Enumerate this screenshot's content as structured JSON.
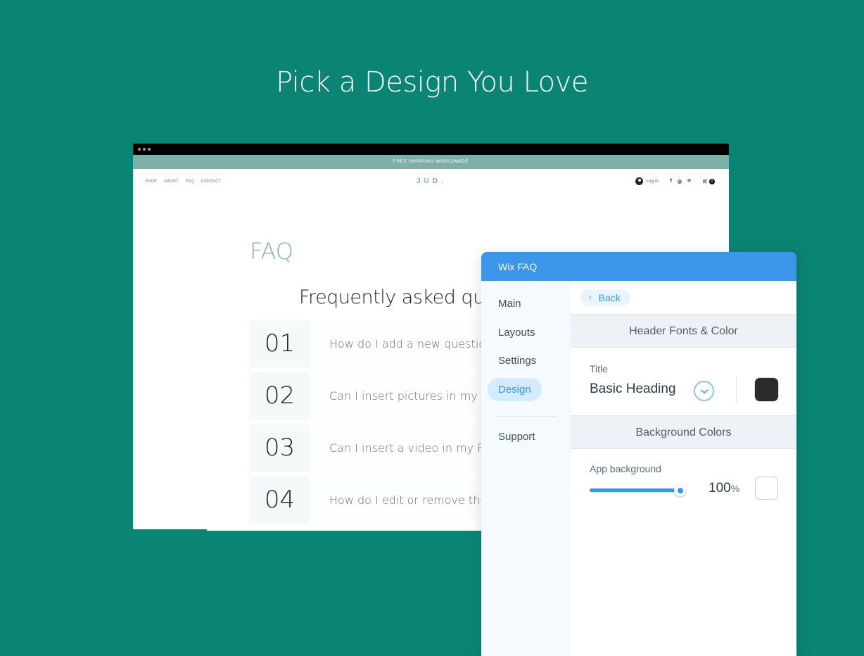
{
  "hero": {
    "title": "Pick a Design You Love"
  },
  "site": {
    "promo": "FREE SHIPPING WORLDWIDE",
    "nav": [
      "SHOP",
      "ABOUT",
      "FAQ",
      "CONTACT"
    ],
    "logo": "JUD.",
    "login": "Log In",
    "social": {
      "facebook": "f",
      "instagram": "◎",
      "pinterest": "℗"
    },
    "cart_count": "0",
    "faq_title": "FAQ",
    "faq_subtitle": "Frequently asked questions",
    "questions": [
      {
        "num": "01",
        "text": "How do I add a new question?"
      },
      {
        "num": "02",
        "text": "Can I insert pictures in my FAQ?"
      },
      {
        "num": "03",
        "text": "Can I insert a video in my FAQ?"
      },
      {
        "num": "04",
        "text": "How do I edit or remove the \"FAQ\" title?"
      }
    ]
  },
  "panel": {
    "title": "Wix FAQ",
    "sidebar": [
      "Main",
      "Layouts",
      "Settings",
      "Design",
      "Support"
    ],
    "active": "Design",
    "back": "Back",
    "sections": {
      "header": "Header Fonts & Color",
      "title_label": "Title",
      "title_font": "Basic Heading",
      "title_color": "#2b2b2b",
      "background": "Background Colors",
      "bg_label": "App background",
      "bg_opacity": "100",
      "bg_opacity_unit": "%",
      "bg_color": "#ffffff"
    }
  },
  "colors": {
    "page_bg": "#0b8573",
    "accent": "#3b96ea",
    "brand_teal": "#7eb0ab"
  }
}
